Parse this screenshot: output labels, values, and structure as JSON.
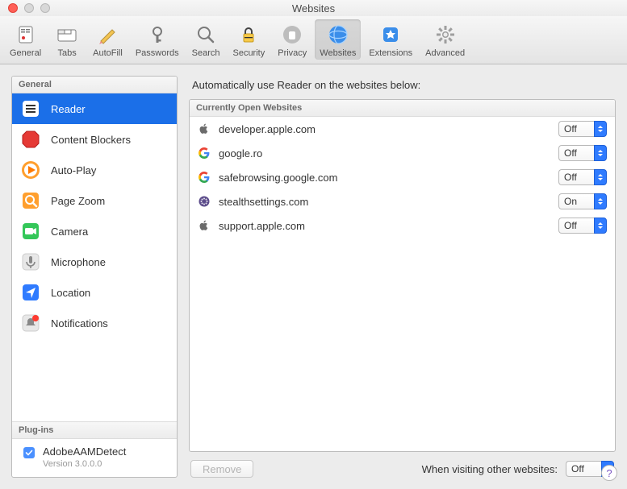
{
  "window": {
    "title": "Websites"
  },
  "toolbar": [
    {
      "id": "general",
      "label": "General"
    },
    {
      "id": "tabs",
      "label": "Tabs"
    },
    {
      "id": "autofill",
      "label": "AutoFill"
    },
    {
      "id": "passwords",
      "label": "Passwords"
    },
    {
      "id": "search",
      "label": "Search"
    },
    {
      "id": "security",
      "label": "Security"
    },
    {
      "id": "privacy",
      "label": "Privacy"
    },
    {
      "id": "websites",
      "label": "Websites",
      "selected": true
    },
    {
      "id": "extensions",
      "label": "Extensions"
    },
    {
      "id": "advanced",
      "label": "Advanced"
    }
  ],
  "sidebar": {
    "group_general": "General",
    "items": [
      {
        "id": "reader",
        "label": "Reader",
        "selected": true
      },
      {
        "id": "content-blockers",
        "label": "Content Blockers"
      },
      {
        "id": "auto-play",
        "label": "Auto-Play"
      },
      {
        "id": "page-zoom",
        "label": "Page Zoom"
      },
      {
        "id": "camera",
        "label": "Camera"
      },
      {
        "id": "microphone",
        "label": "Microphone"
      },
      {
        "id": "location",
        "label": "Location"
      },
      {
        "id": "notifications",
        "label": "Notifications"
      }
    ],
    "group_plugins": "Plug-ins",
    "plugin": {
      "name": "AdobeAAMDetect",
      "version": "Version 3.0.0.0",
      "enabled": true
    }
  },
  "main": {
    "instruction": "Automatically use Reader on the websites below:",
    "header": "Currently Open Websites",
    "rows": [
      {
        "icon": "apple",
        "domain": "developer.apple.com",
        "value": "Off"
      },
      {
        "icon": "google",
        "domain": "google.ro",
        "value": "Off"
      },
      {
        "icon": "google",
        "domain": "safebrowsing.google.com",
        "value": "Off"
      },
      {
        "icon": "stealth",
        "domain": "stealthsettings.com",
        "value": "On"
      },
      {
        "icon": "apple",
        "domain": "support.apple.com",
        "value": "Off"
      }
    ],
    "remove_label": "Remove",
    "other_label": "When visiting other websites:",
    "other_value": "Off"
  },
  "help_label": "?"
}
